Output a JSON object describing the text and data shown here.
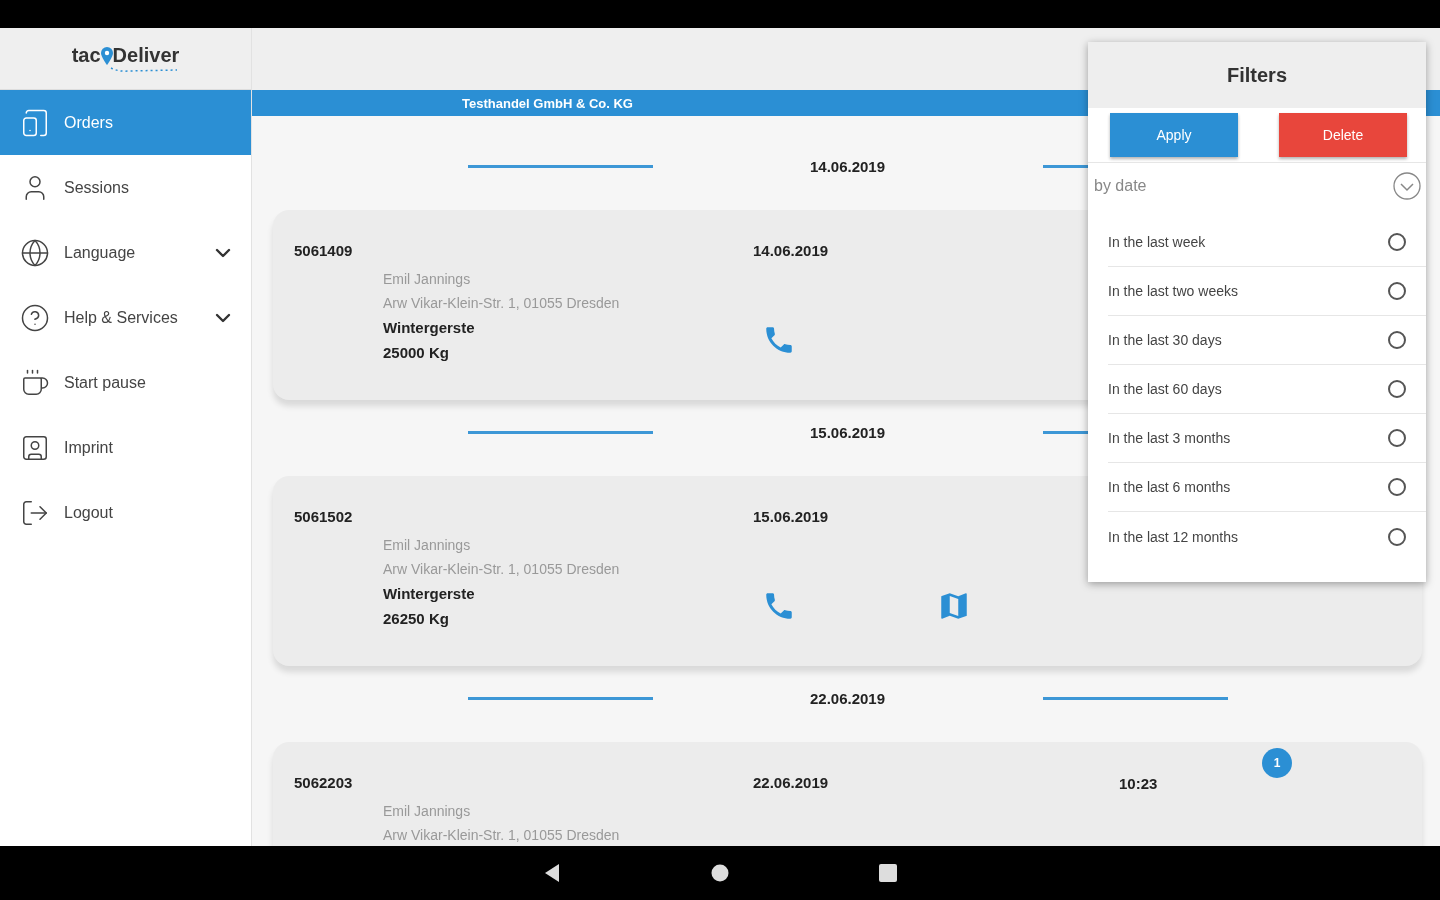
{
  "logo": {
    "part_1": "tac",
    "part_2": "Deliver"
  },
  "sidebar": {
    "items": [
      {
        "label": "Orders",
        "selected": true,
        "expandable": false
      },
      {
        "label": "Sessions",
        "selected": false,
        "expandable": false
      },
      {
        "label": "Language",
        "selected": false,
        "expandable": true
      },
      {
        "label": "Help & Services",
        "selected": false,
        "expandable": true
      },
      {
        "label": "Start pause",
        "selected": false,
        "expandable": false
      },
      {
        "label": "Imprint",
        "selected": false,
        "expandable": false
      },
      {
        "label": "Logout",
        "selected": false,
        "expandable": false
      }
    ]
  },
  "company": "Testhandel GmbH & Co. KG",
  "orders": [
    {
      "date_header": "14.06.2019",
      "id": "5061409",
      "date": "14.06.2019",
      "customer": "Emil Jannings",
      "address": "Arw Vikar-Klein-Str. 1, 01055 Dresden",
      "product": "Wintergerste",
      "weight": "25000 Kg",
      "actions": [
        {
          "kind": "phone"
        }
      ]
    },
    {
      "date_header": "15.06.2019",
      "id": "5061502",
      "date": "15.06.2019",
      "customer": "Emil Jannings",
      "address": "Arw Vikar-Klein-Str. 1, 01055 Dresden",
      "product": "Wintergerste",
      "weight": "26250 Kg",
      "actions": [
        {
          "kind": "phone"
        },
        {
          "kind": "map"
        }
      ]
    },
    {
      "date_header": "22.06.2019",
      "id": "5062203",
      "date": "22.06.2019",
      "time": "10:23",
      "badge": "1",
      "customer": "Emil Jannings",
      "address": "Arw Vikar-Klein-Str. 1, 01055 Dresden"
    }
  ],
  "filters": {
    "title": "Filters",
    "apply": "Apply",
    "delete": "Delete",
    "group": "by date",
    "options": [
      {
        "label": "In the last week",
        "selected": false
      },
      {
        "label": "In the last two weeks",
        "selected": false
      },
      {
        "label": "In the last 30 days",
        "selected": false
      },
      {
        "label": "In the last 60 days",
        "selected": false
      },
      {
        "label": "In the last 3 months",
        "selected": false
      },
      {
        "label": "In the last 6 months",
        "selected": false
      },
      {
        "label": "In the last 12 months",
        "selected": false
      }
    ]
  }
}
